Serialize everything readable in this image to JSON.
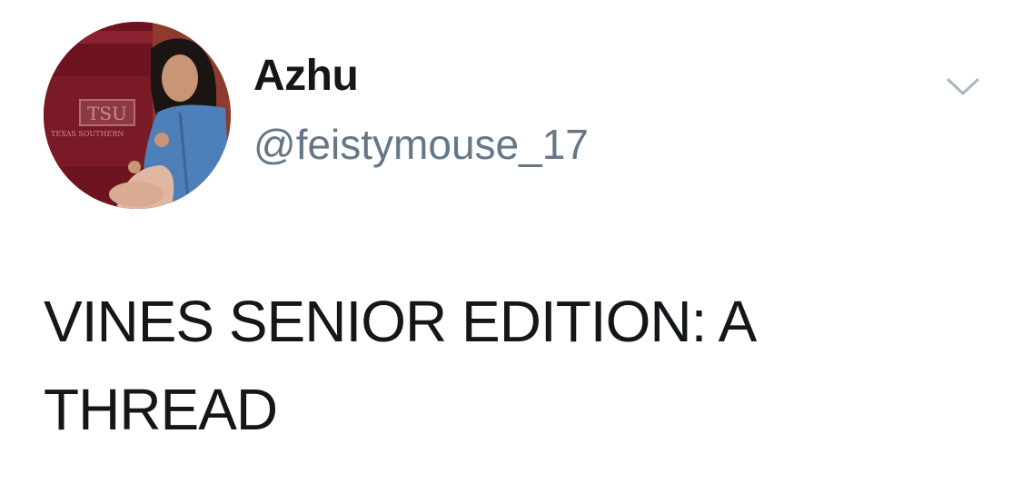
{
  "author": {
    "display_name": "Azhu",
    "handle": "@feistymouse_17",
    "avatar_icon": "profile-photo"
  },
  "menu": {
    "icon": "chevron-down-icon"
  },
  "tweet": {
    "text": "VINES SENIOR EDITION: A THREAD"
  },
  "colors": {
    "text_primary": "#14171a",
    "text_secondary": "#657786",
    "chevron": "#aab8c2",
    "background": "#ffffff"
  }
}
